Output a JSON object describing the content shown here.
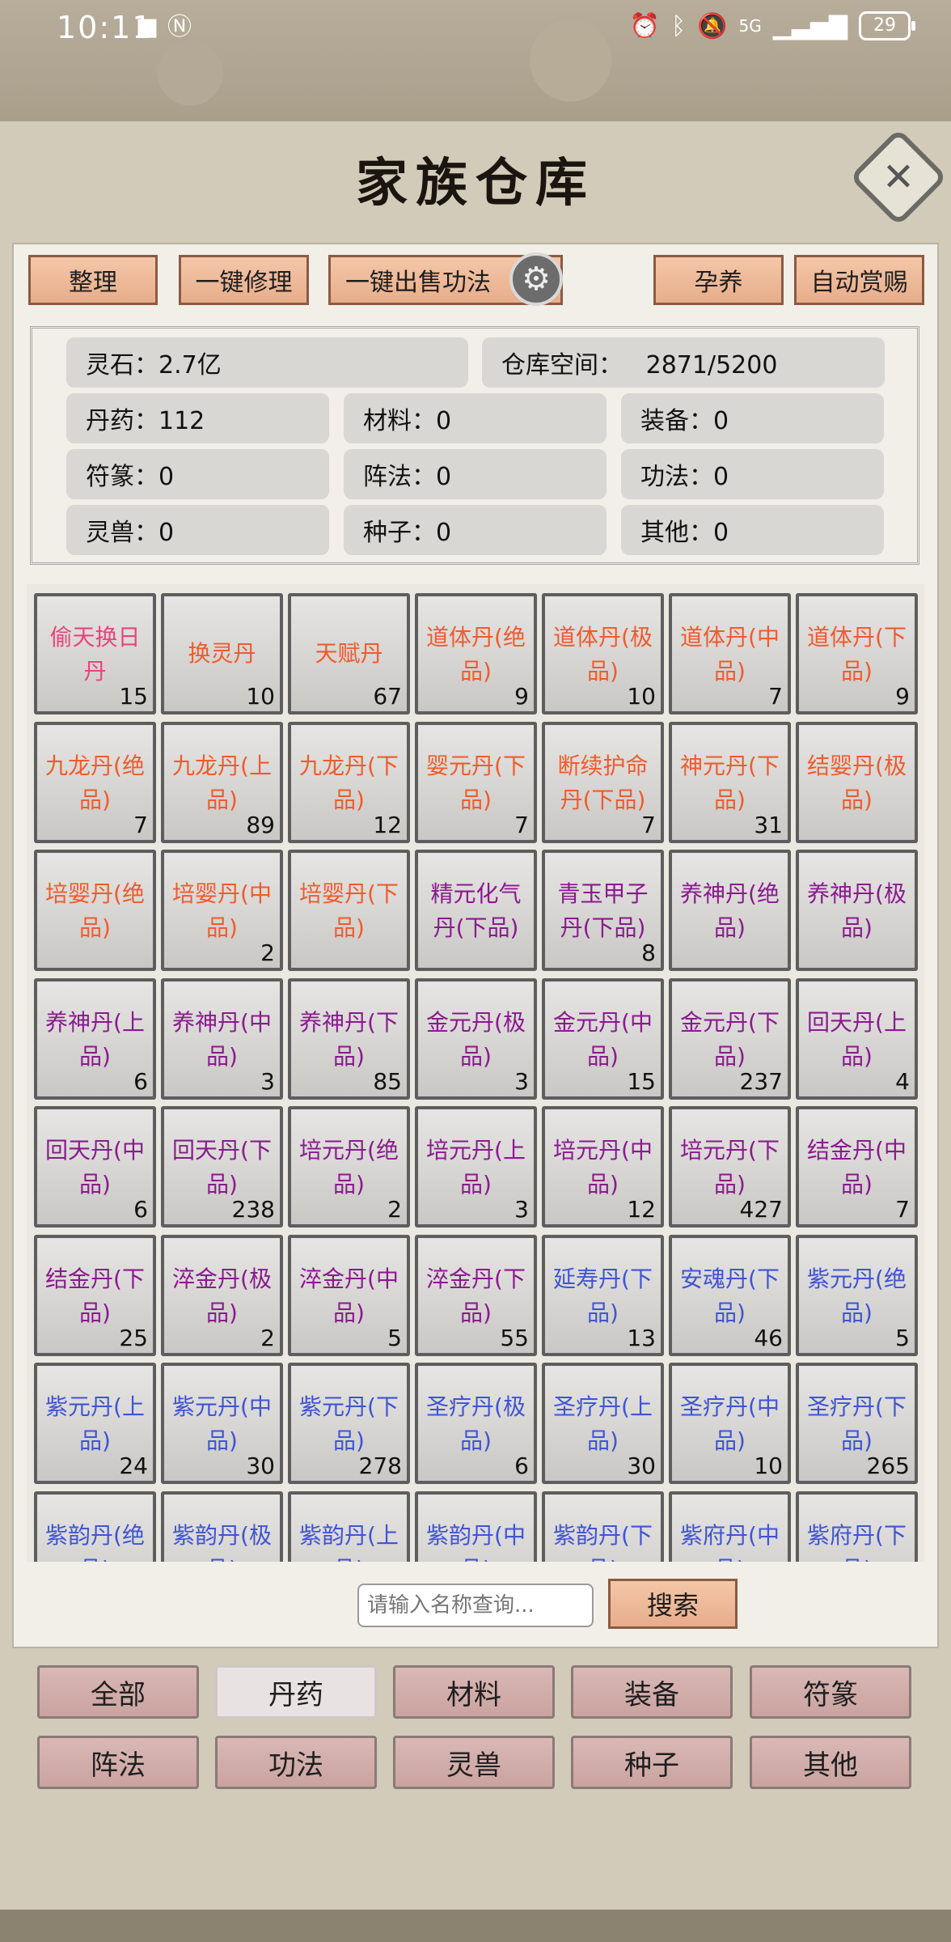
{
  "status_bar": {
    "time": "10:11",
    "left_icons": [
      "app-icon",
      "nfc-icon"
    ],
    "right_icons": [
      "alarm-icon",
      "bluetooth-icon",
      "mute-icon",
      "signal-5g-icon",
      "signal-bars-icon"
    ],
    "battery": "29",
    "network": "5G"
  },
  "title": "家族仓库",
  "toolbar": {
    "organize": "整理",
    "repair_all": "一键修理",
    "sell_skills": "一键出售功法",
    "nurture": "孕养",
    "auto_reward": "自动赏赐"
  },
  "stats": {
    "spirit_stone": "灵石：2.7亿",
    "space": "仓库空间：   2871/5200",
    "pills": "丹药：112",
    "materials": "材料：0",
    "equipment": "装备：0",
    "talismans": "符篆：0",
    "formations": "阵法：0",
    "skills": "功法：0",
    "beasts": "灵兽：0",
    "seeds": "种子：0",
    "others": "其他：0"
  },
  "colors": {
    "pink": "#e8447f",
    "orange": "#f05b2c",
    "purple": "#8a1a8e",
    "blue": "#4054d4"
  },
  "items": [
    {
      "name": "偷天换日丹",
      "count": "15",
      "color": "#e8447f"
    },
    {
      "name": "换灵丹",
      "count": "10",
      "color": "#f05b2c"
    },
    {
      "name": "天赋丹",
      "count": "67",
      "color": "#f05b2c"
    },
    {
      "name": "道体丹(绝品)",
      "count": "9",
      "color": "#f05b2c"
    },
    {
      "name": "道体丹(极品)",
      "count": "10",
      "color": "#f05b2c"
    },
    {
      "name": "道体丹(中品)",
      "count": "7",
      "color": "#f05b2c"
    },
    {
      "name": "道体丹(下品)",
      "count": "9",
      "color": "#f05b2c"
    },
    {
      "name": "九龙丹(绝品)",
      "count": "7",
      "color": "#f05b2c"
    },
    {
      "name": "九龙丹(上品)",
      "count": "89",
      "color": "#f05b2c"
    },
    {
      "name": "九龙丹(下品)",
      "count": "12",
      "color": "#f05b2c"
    },
    {
      "name": "婴元丹(下品)",
      "count": "7",
      "color": "#f05b2c"
    },
    {
      "name": "断续护命丹(下品)",
      "count": "7",
      "color": "#f05b2c"
    },
    {
      "name": "神元丹(下品)",
      "count": "31",
      "color": "#f05b2c"
    },
    {
      "name": "结婴丹(极品)",
      "count": "",
      "color": "#f05b2c"
    },
    {
      "name": "培婴丹(绝品)",
      "count": "",
      "color": "#f05b2c"
    },
    {
      "name": "培婴丹(中品)",
      "count": "2",
      "color": "#f05b2c"
    },
    {
      "name": "培婴丹(下品)",
      "count": "",
      "color": "#f05b2c"
    },
    {
      "name": "精元化气丹(下品)",
      "count": "",
      "color": "#8a1a8e"
    },
    {
      "name": "青玉甲子丹(下品)",
      "count": "8",
      "color": "#8a1a8e"
    },
    {
      "name": "养神丹(绝品)",
      "count": "",
      "color": "#8a1a8e"
    },
    {
      "name": "养神丹(极品)",
      "count": "",
      "color": "#8a1a8e"
    },
    {
      "name": "养神丹(上品)",
      "count": "6",
      "color": "#8a1a8e"
    },
    {
      "name": "养神丹(中品)",
      "count": "3",
      "color": "#8a1a8e"
    },
    {
      "name": "养神丹(下品)",
      "count": "85",
      "color": "#8a1a8e"
    },
    {
      "name": "金元丹(极品)",
      "count": "3",
      "color": "#8a1a8e"
    },
    {
      "name": "金元丹(中品)",
      "count": "15",
      "color": "#8a1a8e"
    },
    {
      "name": "金元丹(下品)",
      "count": "237",
      "color": "#8a1a8e"
    },
    {
      "name": "回天丹(上品)",
      "count": "4",
      "color": "#8a1a8e"
    },
    {
      "name": "回天丹(中品)",
      "count": "6",
      "color": "#8a1a8e"
    },
    {
      "name": "回天丹(下品)",
      "count": "238",
      "color": "#8a1a8e"
    },
    {
      "name": "培元丹(绝品)",
      "count": "2",
      "color": "#8a1a8e"
    },
    {
      "name": "培元丹(上品)",
      "count": "3",
      "color": "#8a1a8e"
    },
    {
      "name": "培元丹(中品)",
      "count": "12",
      "color": "#8a1a8e"
    },
    {
      "name": "培元丹(下品)",
      "count": "427",
      "color": "#8a1a8e"
    },
    {
      "name": "结金丹(中品)",
      "count": "7",
      "color": "#8a1a8e"
    },
    {
      "name": "结金丹(下品)",
      "count": "25",
      "color": "#8a1a8e"
    },
    {
      "name": "淬金丹(极品)",
      "count": "2",
      "color": "#8a1a8e"
    },
    {
      "name": "淬金丹(中品)",
      "count": "5",
      "color": "#8a1a8e"
    },
    {
      "name": "淬金丹(下品)",
      "count": "55",
      "color": "#8a1a8e"
    },
    {
      "name": "延寿丹(下品)",
      "count": "13",
      "color": "#4054d4"
    },
    {
      "name": "安魂丹(下品)",
      "count": "46",
      "color": "#4054d4"
    },
    {
      "name": "紫元丹(绝品)",
      "count": "5",
      "color": "#4054d4"
    },
    {
      "name": "紫元丹(上品)",
      "count": "24",
      "color": "#4054d4"
    },
    {
      "name": "紫元丹(中品)",
      "count": "30",
      "color": "#4054d4"
    },
    {
      "name": "紫元丹(下品)",
      "count": "278",
      "color": "#4054d4"
    },
    {
      "name": "圣疗丹(极品)",
      "count": "6",
      "color": "#4054d4"
    },
    {
      "name": "圣疗丹(上品)",
      "count": "30",
      "color": "#4054d4"
    },
    {
      "name": "圣疗丹(中品)",
      "count": "10",
      "color": "#4054d4"
    },
    {
      "name": "圣疗丹(下品)",
      "count": "265",
      "color": "#4054d4"
    },
    {
      "name": "紫韵丹(绝品)",
      "count": "",
      "color": "#4054d4"
    },
    {
      "name": "紫韵丹(极品)",
      "count": "",
      "color": "#4054d4"
    },
    {
      "name": "紫韵丹(上品)",
      "count": "",
      "color": "#4054d4"
    },
    {
      "name": "紫韵丹(中品)",
      "count": "",
      "color": "#4054d4"
    },
    {
      "name": "紫韵丹(下品)",
      "count": "",
      "color": "#4054d4"
    },
    {
      "name": "紫府丹(中品)",
      "count": "",
      "color": "#4054d4"
    },
    {
      "name": "紫府丹(下品)",
      "count": "",
      "color": "#4054d4"
    }
  ],
  "search": {
    "placeholder": "请输入名称查询...",
    "button": "搜索"
  },
  "tabs": [
    {
      "label": "全部",
      "active": false
    },
    {
      "label": "丹药",
      "active": true
    },
    {
      "label": "材料",
      "active": false
    },
    {
      "label": "装备",
      "active": false
    },
    {
      "label": "符篆",
      "active": false
    },
    {
      "label": "阵法",
      "active": false
    },
    {
      "label": "功法",
      "active": false
    },
    {
      "label": "灵兽",
      "active": false
    },
    {
      "label": "种子",
      "active": false
    },
    {
      "label": "其他",
      "active": false
    }
  ]
}
